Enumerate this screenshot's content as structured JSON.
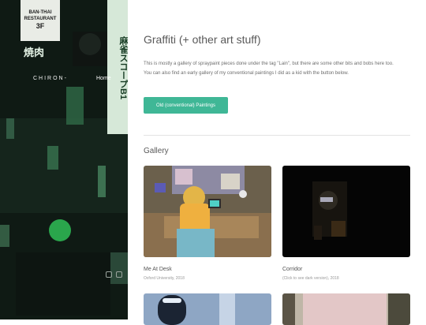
{
  "sidebar": {
    "site_name": "CHIRON-",
    "nav_home": "Home",
    "restaurant_sign": {
      "line1": "BAN-THAI",
      "line2": "RESTAURANT",
      "line3": "3F"
    },
    "vertical_sign": "麻雀スコープB1",
    "yakiniku_sign": "焼肉"
  },
  "main": {
    "title": "Graffiti (+ other art stuff)",
    "intro_line1": "This is mostly a gallery of spraypaint pieces done under the tag \"Lain\", but there are some other bits and bobs here too.",
    "intro_line2": "You can also find an early gallery of my conventional paintings I did as a kid with the button below.",
    "button_label": "Old (conventional) Paintings",
    "gallery_title": "Gallery",
    "items": [
      {
        "title": "Me At Desk",
        "subtitle": "Oxford University, 2018"
      },
      {
        "title": "Corridor",
        "subtitle": "(Click to see dark version), 2018"
      },
      {
        "title": "",
        "subtitle": ""
      },
      {
        "title": "",
        "subtitle": ""
      }
    ]
  },
  "colors": {
    "accent": "#3fb796",
    "sidebar_bg": "#0d1612",
    "title_text": "#595959"
  }
}
